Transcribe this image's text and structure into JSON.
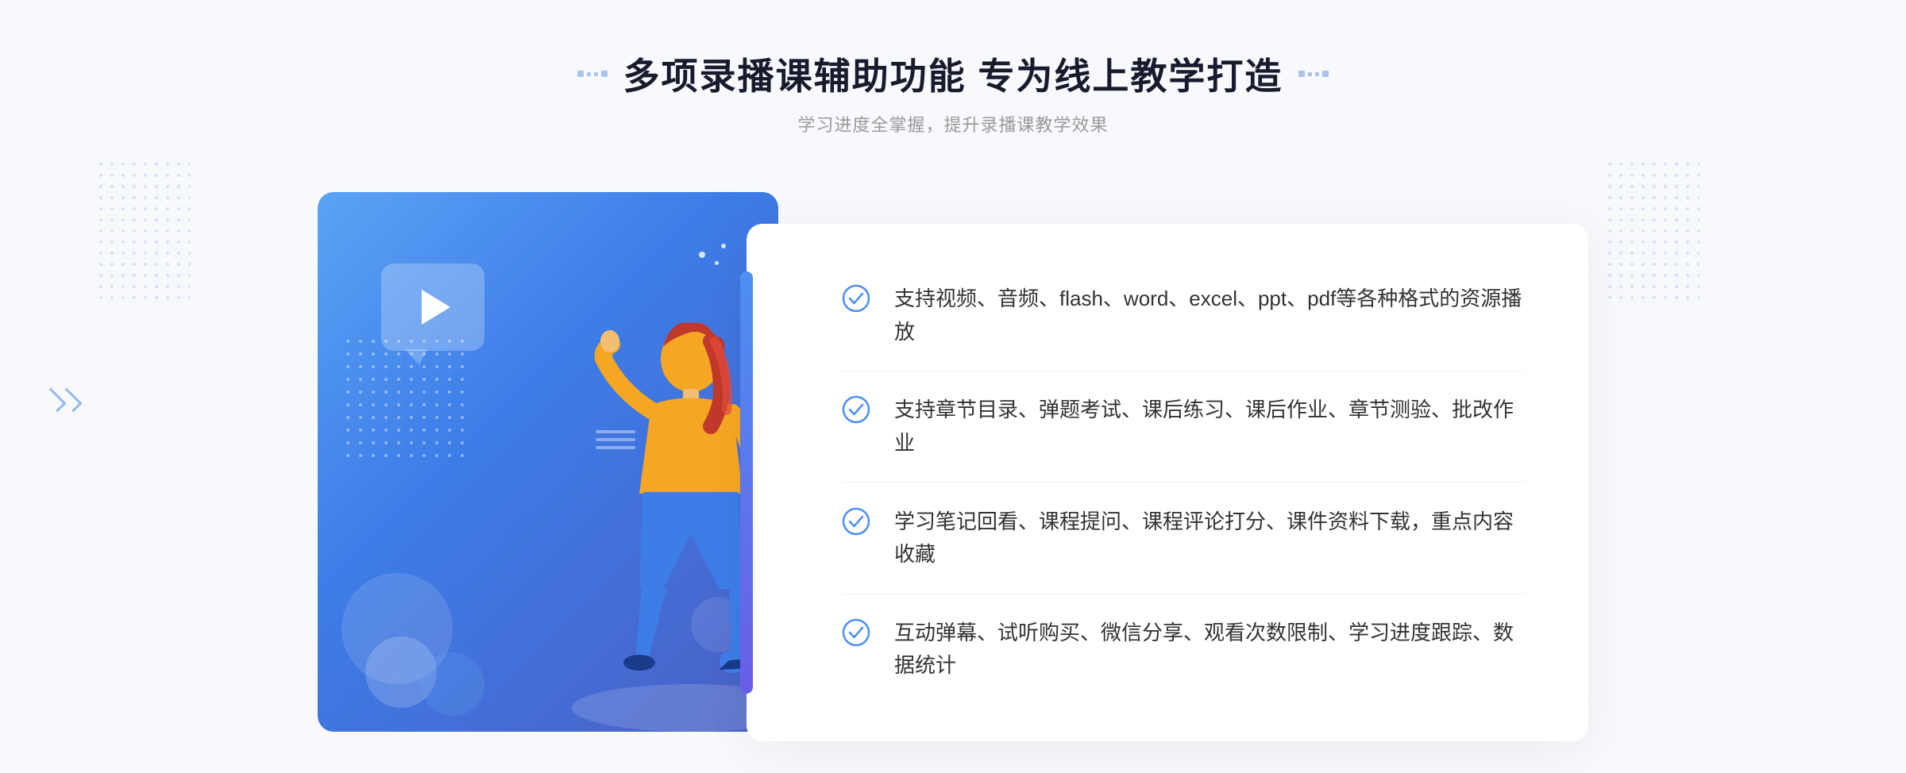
{
  "header": {
    "title": "多项录播课辅助功能 专为线上教学打造",
    "subtitle": "学习进度全掌握，提升录播课教学效果"
  },
  "features": [
    {
      "id": "feature-1",
      "text": "支持视频、音频、flash、word、excel、ppt、pdf等各种格式的资源播放"
    },
    {
      "id": "feature-2",
      "text": "支持章节目录、弹题考试、课后练习、课后作业、章节测验、批改作业"
    },
    {
      "id": "feature-3",
      "text": "学习笔记回看、课程提问、课程评论打分、课件资料下载，重点内容收藏"
    },
    {
      "id": "feature-4",
      "text": "互动弹幕、试听购买、微信分享、观看次数限制、学习进度跟踪、数据统计"
    }
  ],
  "colors": {
    "primary_blue": "#4d90f0",
    "gradient_start": "#5ba3f5",
    "gradient_end": "#4a5fc4",
    "text_dark": "#1a1a2e",
    "text_gray": "#999999",
    "text_feature": "#333333",
    "check_color": "#4d90f0"
  }
}
